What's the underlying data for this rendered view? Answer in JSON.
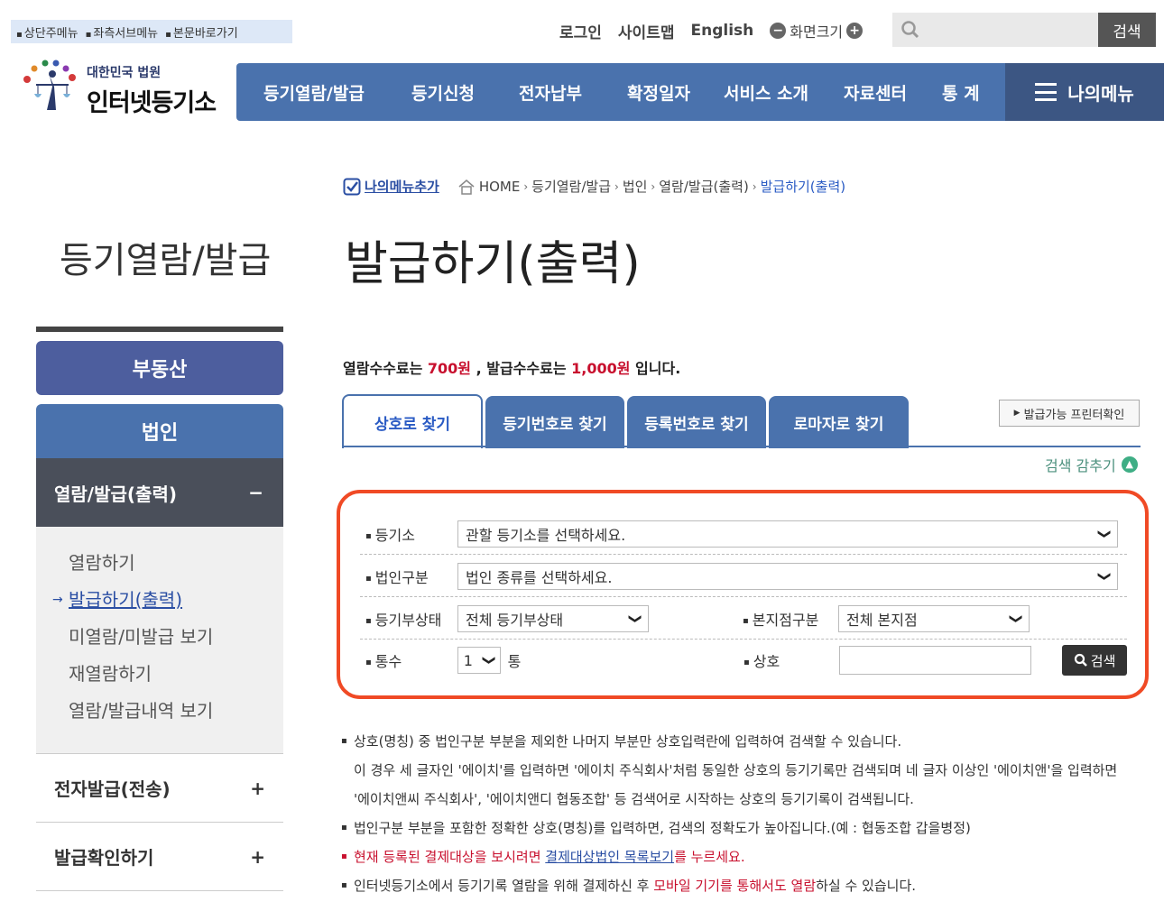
{
  "skip_links": [
    "상단주메뉴",
    "좌측서브메뉴",
    "본문바로가기"
  ],
  "util": {
    "login": "로그인",
    "sitemap": "사이트맵",
    "english": "English",
    "zoom_label": "화면크기"
  },
  "search": {
    "placeholder": "",
    "button": "검색"
  },
  "logo": {
    "small": "대한민국 법원",
    "big": "인터넷등기소"
  },
  "gnb": {
    "items": [
      "등기열람/발급",
      "등기신청",
      "전자납부",
      "확정일자",
      "서비스 소개",
      "자료센터",
      "통 계"
    ],
    "mymenu": "나의메뉴"
  },
  "breadcrumb": {
    "add_menu": "나의메뉴추가",
    "items": [
      "HOME",
      "등기열람/발급",
      "법인",
      "열람/발급(출력)"
    ],
    "current": "발급하기(출력)"
  },
  "side_title": "등기열람/발급",
  "page_title": "발급하기(출력)",
  "lnb": {
    "main": "부동산",
    "sub": "법인",
    "open": {
      "label": "열람/발급(출력)",
      "toggle": "−"
    },
    "subs": [
      "열람하기",
      "발급하기(출력)",
      "미열람/미발급 보기",
      "재열람하기",
      "열람/발급내역 보기"
    ],
    "closed": [
      {
        "label": "전자발급(전송)",
        "toggle": "+"
      },
      {
        "label": "발급확인하기",
        "toggle": "+"
      }
    ]
  },
  "fee": {
    "pre": "열람수수료는 ",
    "view_fee": "700원",
    "mid": " , 발급수수료는 ",
    "issue_fee": "1,000원",
    "post": " 입니다."
  },
  "tabs": [
    "상호로 찾기",
    "등기번호로 찾기",
    "등록번호로 찾기",
    "로마자로 찾기"
  ],
  "printer_btn": "발급가능 프린터확인",
  "hide_search": "검색 감추기",
  "form": {
    "registry_label": "등기소",
    "registry_value": "관할 등기소를 선택하세요.",
    "corp_type_label": "법인구분",
    "corp_type_value": "법인 종류를 선택하세요.",
    "status_label": "등기부상태",
    "status_value": "전체 등기부상태",
    "branch_label": "본지점구분",
    "branch_value": "전체 본지점",
    "copies_label": "통수",
    "copies_value": "1",
    "copies_unit": "통",
    "name_label": "상호",
    "name_value": "",
    "search_button": "검색"
  },
  "notes": {
    "n1": "상호(명칭) 중 법인구분 부분을 제외한 나머지 부분만 상호입력란에 입력하여 검색할 수 있습니다.",
    "n1c1": "이 경우 세 글자인 '에이치'를 입력하면 '에이치 주식회사'처럼 동일한 상호의 등기기록만 검색되며 네 글자 이상인 '에이치앤'을 입력하면",
    "n1c2": "'에이치앤씨 주식회사', '에이치앤디 협동조합' 등 검색어로 시작하는 상호의 등기기록이 검색됩니다.",
    "n2": "법인구분 부분을 포함한 정확한 상호(명칭)를 입력하면, 검색의 정확도가 높아집니다.(예 : 협동조합 갑을병정)",
    "n3_pre": "현재 등록된 결제대상을 보시려면 ",
    "n3_link": "결제대상법인 목록보기",
    "n3_post": "를 누르세요.",
    "n4_pre": "인터넷등기소에서 등기기록 열람을 위해 결제하신 후 ",
    "n4_red": "모바일 기기를 통해서도 열람",
    "n4_post": "하실 수 있습니다."
  },
  "colors": {
    "primary": "#4a72ad",
    "dark": "#3c5683",
    "highlight": "#f04a25",
    "fee_red": "#c8102e"
  }
}
